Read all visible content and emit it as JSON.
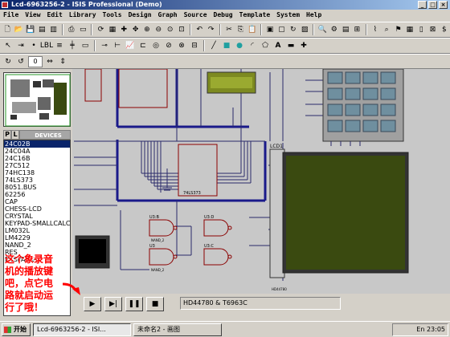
{
  "window": {
    "title": "Lcd-6963256-2 - ISIS Professional (Demo)"
  },
  "menubar": {
    "items": [
      "File",
      "View",
      "Edit",
      "Library",
      "Tools",
      "Design",
      "Graph",
      "Source",
      "Debug",
      "Template",
      "System",
      "Help"
    ]
  },
  "left_panel": {
    "tab_p": "P",
    "tab_l": "L",
    "devices_header": "DEVICES",
    "devices": [
      "24C02B",
      "24C04A",
      "24C16B",
      "27C512",
      "74HC138",
      "74LS373",
      "8051.BUS",
      "62256",
      "CAP",
      "CHESS-LCD",
      "CRYSTAL",
      "KEYPAD-SMALLCALC",
      "LM032L",
      "LM4229",
      "NAND_2",
      "RES",
      "RESPACK-8"
    ],
    "selected_index": 0
  },
  "schematic": {
    "lcd_label": "LCD1",
    "lcd_part": "HD44780",
    "gates": [
      "U3:B",
      "U3:D",
      "U3",
      "U3:C"
    ],
    "gate_type": "NAND_2",
    "chip_label": "74LS373",
    "pin_labels": [
      "VSS",
      "VDD",
      "VEE",
      "RS",
      "RW",
      "E",
      "D0",
      "D1",
      "D2",
      "D3",
      "D4",
      "D5",
      "D6",
      "D7"
    ]
  },
  "status": {
    "text": "HD44780 & T6963C"
  },
  "annotation": {
    "text": "这个象录音\n机的播放键\n吧，点它电\n路就启动运\n行了哦！"
  },
  "taskbar": {
    "start_label": "开始",
    "items": [
      "Lcd-6963256-2 - ISI...",
      "未命名2 - 画图"
    ],
    "lang": "En",
    "time": "23:05"
  },
  "colors": {
    "title_start": "#0a246a",
    "title_end": "#a6caf0",
    "lcd_screen": "#3a4a10",
    "wire": "#1a1a8a",
    "component": "#8b0000",
    "annotation": "#ff0000"
  }
}
